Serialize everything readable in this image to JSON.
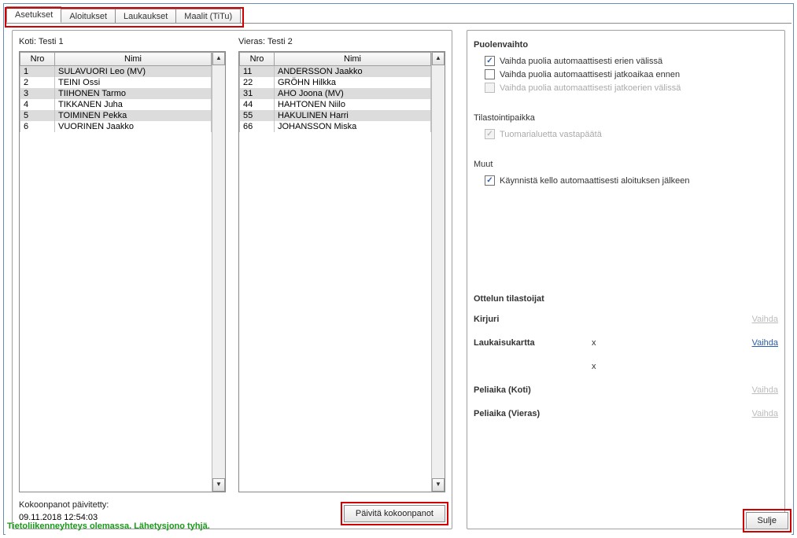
{
  "tabs": {
    "items": [
      {
        "label": "Asetukset",
        "active": true
      },
      {
        "label": "Aloitukset",
        "active": false
      },
      {
        "label": "Laukaukset",
        "active": false
      },
      {
        "label": "Maalit (TiTu)",
        "active": false
      }
    ]
  },
  "left": {
    "home_label": "Koti: Testi 1",
    "away_label": "Vieras: Testi 2",
    "columns": {
      "nro": "Nro",
      "name": "Nimi"
    },
    "home_roster": [
      {
        "nro": "1",
        "name": "SULAVUORI Leo (MV)"
      },
      {
        "nro": "2",
        "name": "TEINI Ossi"
      },
      {
        "nro": "3",
        "name": "TIIHONEN Tarmo"
      },
      {
        "nro": "4",
        "name": "TIKKANEN Juha"
      },
      {
        "nro": "5",
        "name": "TOIMINEN Pekka"
      },
      {
        "nro": "6",
        "name": "VUORINEN Jaakko"
      }
    ],
    "away_roster": [
      {
        "nro": "11",
        "name": "ANDERSSON Jaakko"
      },
      {
        "nro": "22",
        "name": "GRÖHN Hilkka"
      },
      {
        "nro": "31",
        "name": "AHO Joona (MV)"
      },
      {
        "nro": "44",
        "name": "HAHTONEN Niilo"
      },
      {
        "nro": "55",
        "name": "HAKULINEN Harri"
      },
      {
        "nro": "66",
        "name": "JOHANSSON Miska"
      }
    ],
    "updated_label": "Kokoonpanot päivitetty:",
    "updated_value": "09.11.2018 12:54:03",
    "refresh_button": "Päivitä kokoonpanot"
  },
  "right": {
    "sections": {
      "side_change": {
        "title": "Puolenvaihto",
        "opts": [
          {
            "label": "Vaihda puolia automaattisesti erien välissä",
            "checked": true,
            "disabled": false
          },
          {
            "label": "Vaihda puolia automaattisesti jatkoaikaa ennen",
            "checked": false,
            "disabled": false
          },
          {
            "label": "Vaihda puolia automaattisesti jatkoerien välissä",
            "checked": false,
            "disabled": true
          }
        ]
      },
      "stat_place": {
        "title": "Tilastointipaikka",
        "opts": [
          {
            "label": "Tuomarialuetta vastapäätä",
            "checked": true,
            "disabled": true
          }
        ]
      },
      "other": {
        "title": "Muut",
        "opts": [
          {
            "label": "Käynnistä kello automaattisesti aloituksen jälkeen",
            "checked": true,
            "disabled": false
          }
        ]
      },
      "stats_people": {
        "title": "Ottelun tilastoijat",
        "rows": [
          {
            "label": "Kirjuri",
            "mid": "",
            "link": "Vaihda",
            "link_enabled": false
          },
          {
            "label": "Laukaisukartta",
            "mid": "x",
            "link": "Vaihda",
            "link_enabled": true
          },
          {
            "label": "",
            "mid": "x",
            "link": "",
            "link_enabled": false
          },
          {
            "label": "Peliaika (Koti)",
            "mid": "",
            "link": "Vaihda",
            "link_enabled": false
          },
          {
            "label": "Peliaika (Vieras)",
            "mid": "",
            "link": "Vaihda",
            "link_enabled": false
          }
        ]
      }
    }
  },
  "footer": {
    "status": "Tietoliikenneyhteys olemassa. Lähetysjono tyhjä.",
    "close": "Sulje"
  }
}
